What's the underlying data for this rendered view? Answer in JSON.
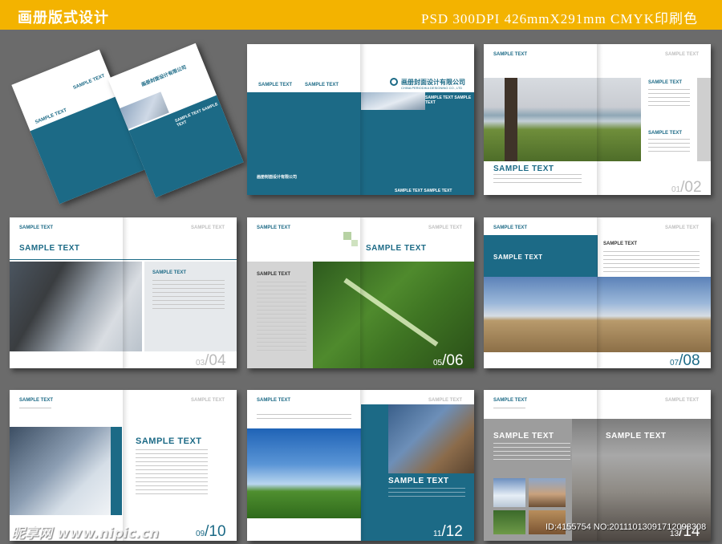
{
  "header": {
    "title": "画册版式设计",
    "spec": "PSD 300DPI  426mmX291mm  CMYK印刷色"
  },
  "cover": {
    "company": "画册封面设计有限公司",
    "company_en": "CHINA PERIODIKA DESIGNING CO., LTD",
    "sample_text": "SAMPLE TEXT",
    "sample_pair": "SAMPLE TEXT SAMPLE TEXT"
  },
  "spreads": {
    "label": "SAMPLE TEXT",
    "heading": "SAMPLE TEXT",
    "pages": [
      {
        "left": "01",
        "right": "02"
      },
      {
        "left": "03",
        "right": "04"
      },
      {
        "left": "05",
        "right": "06"
      },
      {
        "left": "07",
        "right": "08"
      },
      {
        "left": "09",
        "right": "10"
      },
      {
        "left": "11",
        "right": "12"
      },
      {
        "left": "13",
        "right": "14"
      }
    ]
  },
  "footer": {
    "watermark": "昵享网 www.nipic.cn",
    "image_id": "ID:4155754 NO:20111013091712093308"
  },
  "colors": {
    "brand": "#1c6a86",
    "topbar": "#f3b300",
    "background": "#6b6b6b"
  }
}
